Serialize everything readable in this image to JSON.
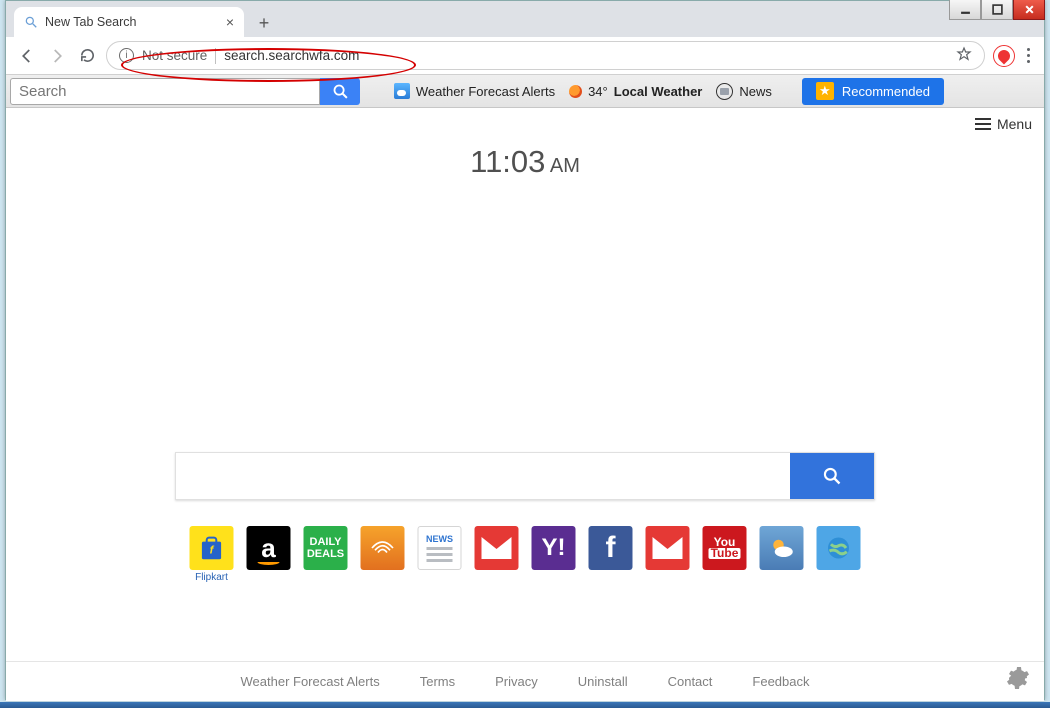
{
  "window_controls": {
    "min": "minimize",
    "max": "maximize",
    "close": "close"
  },
  "browser": {
    "tab_title": "New Tab Search",
    "not_secure_label": "Not secure",
    "url": "search.searchwfa.com"
  },
  "toolbar": {
    "search_placeholder": "Search",
    "wfa_label": "Weather Forecast Alerts",
    "temp": "34°",
    "local_weather_label": "Local Weather",
    "news_label": "News",
    "recommended_label": "Recommended"
  },
  "page": {
    "menu_label": "Menu",
    "clock_time": "11:03",
    "clock_ampm": " AM",
    "tiles": {
      "flipkart": "Flipkart",
      "amazon_letter": "a",
      "daily_deals": "DAILY\nDEALS",
      "news": "NEWS",
      "yahoo": "Y!",
      "facebook": "f",
      "youtube_top": "You",
      "youtube_bot": "Tube"
    }
  },
  "footer": {
    "links": [
      "Weather Forecast Alerts",
      "Terms",
      "Privacy",
      "Uninstall",
      "Contact",
      "Feedback"
    ]
  }
}
